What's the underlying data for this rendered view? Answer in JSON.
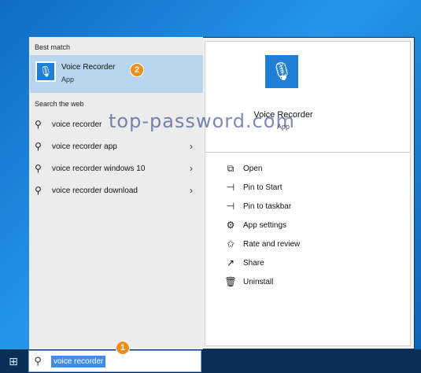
{
  "taskbar": {
    "search_query": "voice recorder",
    "start_icon": "windows-icon",
    "search_icon": "magnifier-icon"
  },
  "badges": {
    "one": "1",
    "two": "2"
  },
  "left": {
    "best_match_label": "Best match",
    "best_match": {
      "title": "Voice Recorder",
      "subtitle": "App",
      "icon": "voice-recorder-icon"
    },
    "web_label": "Search the web",
    "suggestions": [
      {
        "text": "voice recorder",
        "icon": "search-icon"
      },
      {
        "text": "voice recorder app",
        "icon": "search-icon",
        "arrow": "›"
      },
      {
        "text": "voice recorder windows 10",
        "icon": "search-icon",
        "arrow": "›"
      },
      {
        "text": "voice recorder download",
        "icon": "search-icon",
        "arrow": "›"
      }
    ]
  },
  "right": {
    "app_name": "Voice Recorder",
    "app_type": "App",
    "actions": [
      {
        "label": "Open",
        "icon": "open-icon"
      },
      {
        "label": "Pin to Start",
        "icon": "pin-icon"
      },
      {
        "label": "Pin to taskbar",
        "icon": "pin-icon"
      },
      {
        "label": "App settings",
        "icon": "gear-icon"
      },
      {
        "label": "Rate and review",
        "icon": "star-icon"
      },
      {
        "label": "Share",
        "icon": "share-icon"
      },
      {
        "label": "Uninstall",
        "icon": "trash-icon"
      }
    ]
  },
  "watermark": "top-password.com",
  "colors": {
    "accent": "#1f7fd6",
    "badge": "#f08c1a",
    "selected": "#b9d4ef"
  }
}
